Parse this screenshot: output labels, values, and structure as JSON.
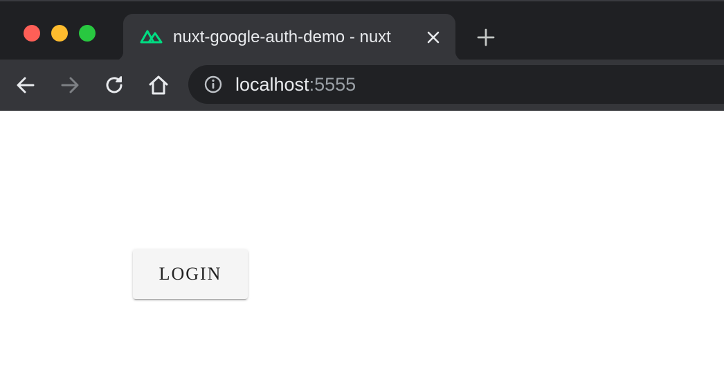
{
  "browser": {
    "tab": {
      "title": "nuxt-google-auth-demo - nuxt",
      "favicon": "nuxt-logo-icon"
    },
    "address_bar": {
      "host": "localhost",
      "port": ":5555"
    },
    "icons": {
      "back": "arrow-left-icon",
      "forward": "arrow-right-icon",
      "reload": "reload-icon",
      "home": "home-icon",
      "info": "info-icon",
      "close_tab": "close-icon",
      "new_tab": "plus-icon"
    },
    "colors": {
      "tabstrip": "#1f2023",
      "toolbar": "#35363a",
      "omnibox": "#202124",
      "nuxt_green": "#00dc82",
      "close": "#fe5f57",
      "minimize": "#febc2e",
      "maximize": "#28c840"
    }
  },
  "page": {
    "login_label": "LOGIN",
    "background": "#ffffff"
  }
}
